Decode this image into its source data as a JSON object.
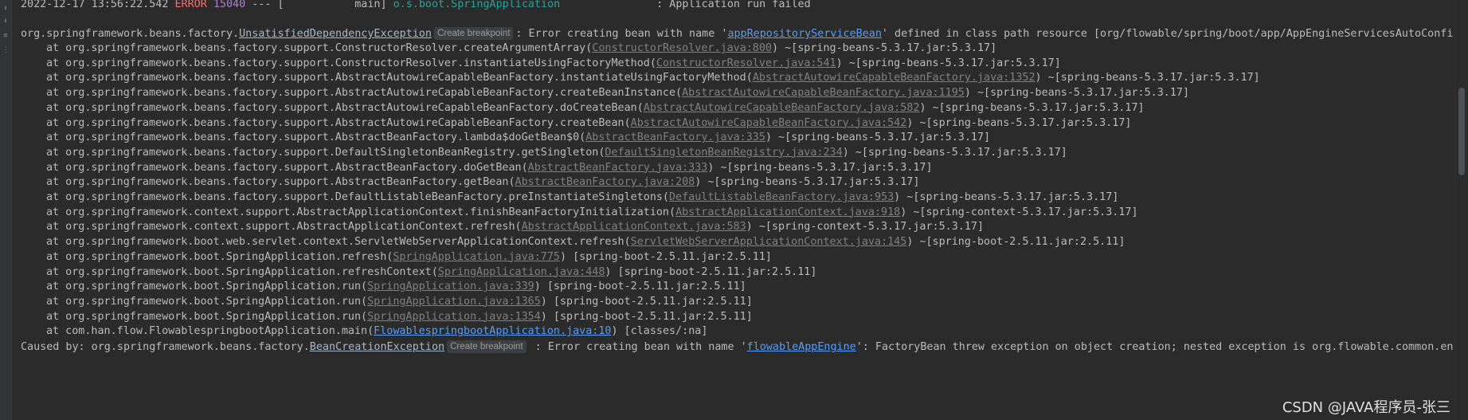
{
  "header": {
    "timestamp": "2022-12-17 13:56:22.542",
    "level": "ERROR",
    "pid": "15040",
    "sep": " --- [           main] ",
    "logger": "o.s.boot.SpringApplication",
    "msg": "               : Application run failed"
  },
  "exception": {
    "prefix": "org.springframework.beans.factory.",
    "class_link": "UnsatisfiedDependencyException",
    "badge": "Create breakpoint",
    "msg_a": ": Error creating bean with name '",
    "bean": "appRepositoryServiceBean",
    "msg_b": "' defined in class path resource [org/flowable/spring/boot/app/AppEngineServicesAutoConfig"
  },
  "stack": [
    {
      "pre": "at org.springframework.beans.factory.support.ConstructorResolver.createArgumentArray(",
      "ref": "ConstructorResolver.java:800",
      "post": ") ~[spring-beans-5.3.17.jar:5.3.17]",
      "style": "ref"
    },
    {
      "pre": "at org.springframework.beans.factory.support.ConstructorResolver.instantiateUsingFactoryMethod(",
      "ref": "ConstructorResolver.java:541",
      "post": ") ~[spring-beans-5.3.17.jar:5.3.17]",
      "style": "ref"
    },
    {
      "pre": "at org.springframework.beans.factory.support.AbstractAutowireCapableBeanFactory.instantiateUsingFactoryMethod(",
      "ref": "AbstractAutowireCapableBeanFactory.java:1352",
      "post": ") ~[spring-beans-5.3.17.jar:5.3.17]",
      "style": "ref"
    },
    {
      "pre": "at org.springframework.beans.factory.support.AbstractAutowireCapableBeanFactory.createBeanInstance(",
      "ref": "AbstractAutowireCapableBeanFactory.java:1195",
      "post": ") ~[spring-beans-5.3.17.jar:5.3.17]",
      "style": "ref"
    },
    {
      "pre": "at org.springframework.beans.factory.support.AbstractAutowireCapableBeanFactory.doCreateBean(",
      "ref": "AbstractAutowireCapableBeanFactory.java:582",
      "post": ") ~[spring-beans-5.3.17.jar:5.3.17]",
      "style": "ref"
    },
    {
      "pre": "at org.springframework.beans.factory.support.AbstractAutowireCapableBeanFactory.createBean(",
      "ref": "AbstractAutowireCapableBeanFactory.java:542",
      "post": ") ~[spring-beans-5.3.17.jar:5.3.17]",
      "style": "ref"
    },
    {
      "pre": "at org.springframework.beans.factory.support.AbstractBeanFactory.lambda$doGetBean$0(",
      "ref": "AbstractBeanFactory.java:335",
      "post": ") ~[spring-beans-5.3.17.jar:5.3.17]",
      "style": "ref"
    },
    {
      "pre": "at org.springframework.beans.factory.support.DefaultSingletonBeanRegistry.getSingleton(",
      "ref": "DefaultSingletonBeanRegistry.java:234",
      "post": ") ~[spring-beans-5.3.17.jar:5.3.17]",
      "style": "ref"
    },
    {
      "pre": "at org.springframework.beans.factory.support.AbstractBeanFactory.doGetBean(",
      "ref": "AbstractBeanFactory.java:333",
      "post": ") ~[spring-beans-5.3.17.jar:5.3.17]",
      "style": "ref"
    },
    {
      "pre": "at org.springframework.beans.factory.support.AbstractBeanFactory.getBean(",
      "ref": "AbstractBeanFactory.java:208",
      "post": ") ~[spring-beans-5.3.17.jar:5.3.17]",
      "style": "ref"
    },
    {
      "pre": "at org.springframework.beans.factory.support.DefaultListableBeanFactory.preInstantiateSingletons(",
      "ref": "DefaultListableBeanFactory.java:953",
      "post": ") ~[spring-beans-5.3.17.jar:5.3.17]",
      "style": "ref"
    },
    {
      "pre": "at org.springframework.context.support.AbstractApplicationContext.finishBeanFactoryInitialization(",
      "ref": "AbstractApplicationContext.java:918",
      "post": ") ~[spring-context-5.3.17.jar:5.3.17]",
      "style": "ref"
    },
    {
      "pre": "at org.springframework.context.support.AbstractApplicationContext.refresh(",
      "ref": "AbstractApplicationContext.java:583",
      "post": ") ~[spring-context-5.3.17.jar:5.3.17]",
      "style": "ref"
    },
    {
      "pre": "at org.springframework.boot.web.servlet.context.ServletWebServerApplicationContext.refresh(",
      "ref": "ServletWebServerApplicationContext.java:145",
      "post": ") ~[spring-boot-2.5.11.jar:2.5.11]",
      "style": "ref"
    },
    {
      "pre": "at org.springframework.boot.SpringApplication.refresh(",
      "ref": "SpringApplication.java:775",
      "post": ") [spring-boot-2.5.11.jar:2.5.11]",
      "style": "ref"
    },
    {
      "pre": "at org.springframework.boot.SpringApplication.refreshContext(",
      "ref": "SpringApplication.java:448",
      "post": ") [spring-boot-2.5.11.jar:2.5.11]",
      "style": "ref"
    },
    {
      "pre": "at org.springframework.boot.SpringApplication.run(",
      "ref": "SpringApplication.java:339",
      "post": ") [spring-boot-2.5.11.jar:2.5.11]",
      "style": "ref"
    },
    {
      "pre": "at org.springframework.boot.SpringApplication.run(",
      "ref": "SpringApplication.java:1365",
      "post": ") [spring-boot-2.5.11.jar:2.5.11]",
      "style": "ref"
    },
    {
      "pre": "at org.springframework.boot.SpringApplication.run(",
      "ref": "SpringApplication.java:1354",
      "post": ") [spring-boot-2.5.11.jar:2.5.11]",
      "style": "ref"
    },
    {
      "pre": "at com.han.flow.FlowablespringbootApplication.main(",
      "ref": "FlowablespringbootApplication.java:10",
      "post": ") [classes/:na]",
      "style": "beanlink"
    }
  ],
  "caused_by": {
    "prefix": "Caused by: org.springframework.beans.factory.",
    "class_link": "BeanCreationException",
    "badge": "Create breakpoint",
    "msg_a": " : Error creating bean with name '",
    "bean": "flowableAppEngine",
    "msg_b": "': FactoryBean threw exception on object creation; nested exception is org.flowable.common.engi"
  },
  "watermark": "CSDN @JAVA程序员-张三",
  "colors": {
    "background": "#2b2b2b",
    "error": "#ff6b68",
    "pid": "#b07dd1",
    "logger": "#2aa198",
    "link": "#589df6"
  }
}
